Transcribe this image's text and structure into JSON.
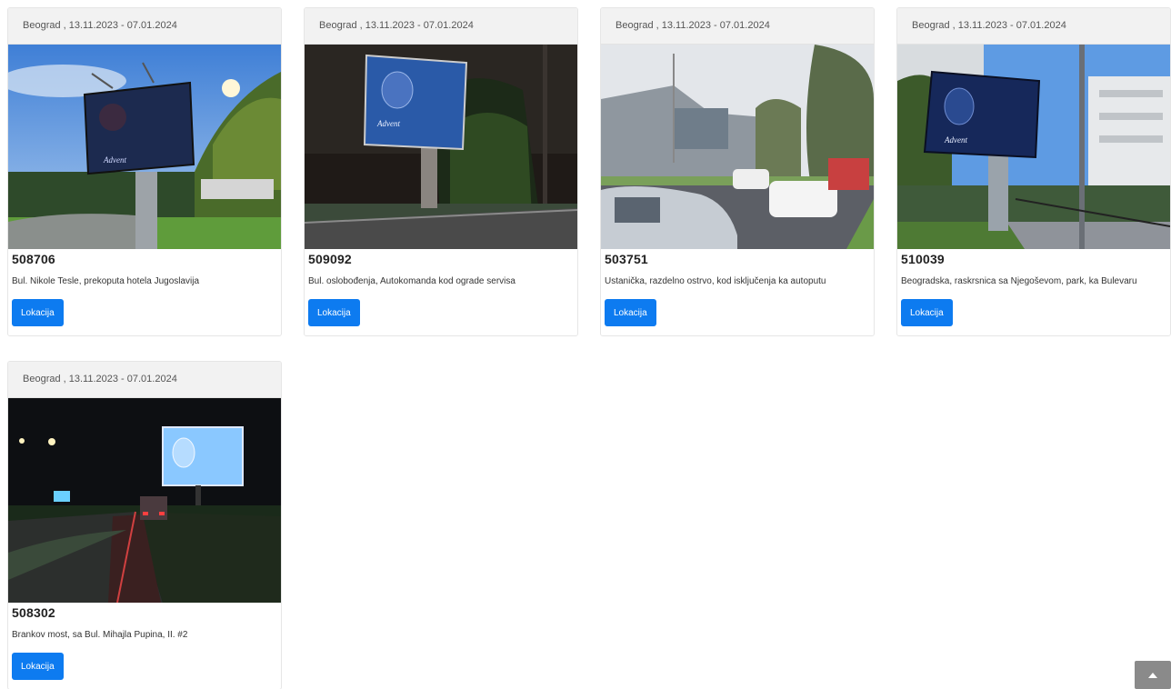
{
  "cards": [
    {
      "header": "Beograd , 13.11.2023 - 07.01.2024",
      "id": "508706",
      "address": "Bul. Nikole Tesle, prekoputa hotela Jugoslavija",
      "button": "Lokacija",
      "scene": "day-park"
    },
    {
      "header": "Beograd , 13.11.2023 - 07.01.2024",
      "id": "509092",
      "address": "Bul. oslobođenja, Autokomanda kod ograde servisa",
      "button": "Lokacija",
      "scene": "dusk-trees"
    },
    {
      "header": "Beograd , 13.11.2023 - 07.01.2024",
      "id": "503751",
      "address": "Ustanička, razdelno ostrvo, kod isključenja ka autoputu",
      "button": "Lokacija",
      "scene": "day-road"
    },
    {
      "header": "Beograd , 13.11.2023 - 07.01.2024",
      "id": "510039",
      "address": "Beogradska, raskrsnica sa Njegoševom, park, ka Bulevaru",
      "button": "Lokacija",
      "scene": "day-crossing"
    },
    {
      "header": "Beograd , 13.11.2023 - 07.01.2024",
      "id": "508302",
      "address": "Brankov most, sa Bul. Mihajla Pupina, II. #2",
      "button": "Lokacija",
      "scene": "night-road"
    }
  ],
  "scroll_top": {
    "icon": "caret-up-icon"
  },
  "colors": {
    "button": "#0d7bf0",
    "header_bg": "#f2f2f2",
    "scroll_top": "#8a8a8a"
  }
}
